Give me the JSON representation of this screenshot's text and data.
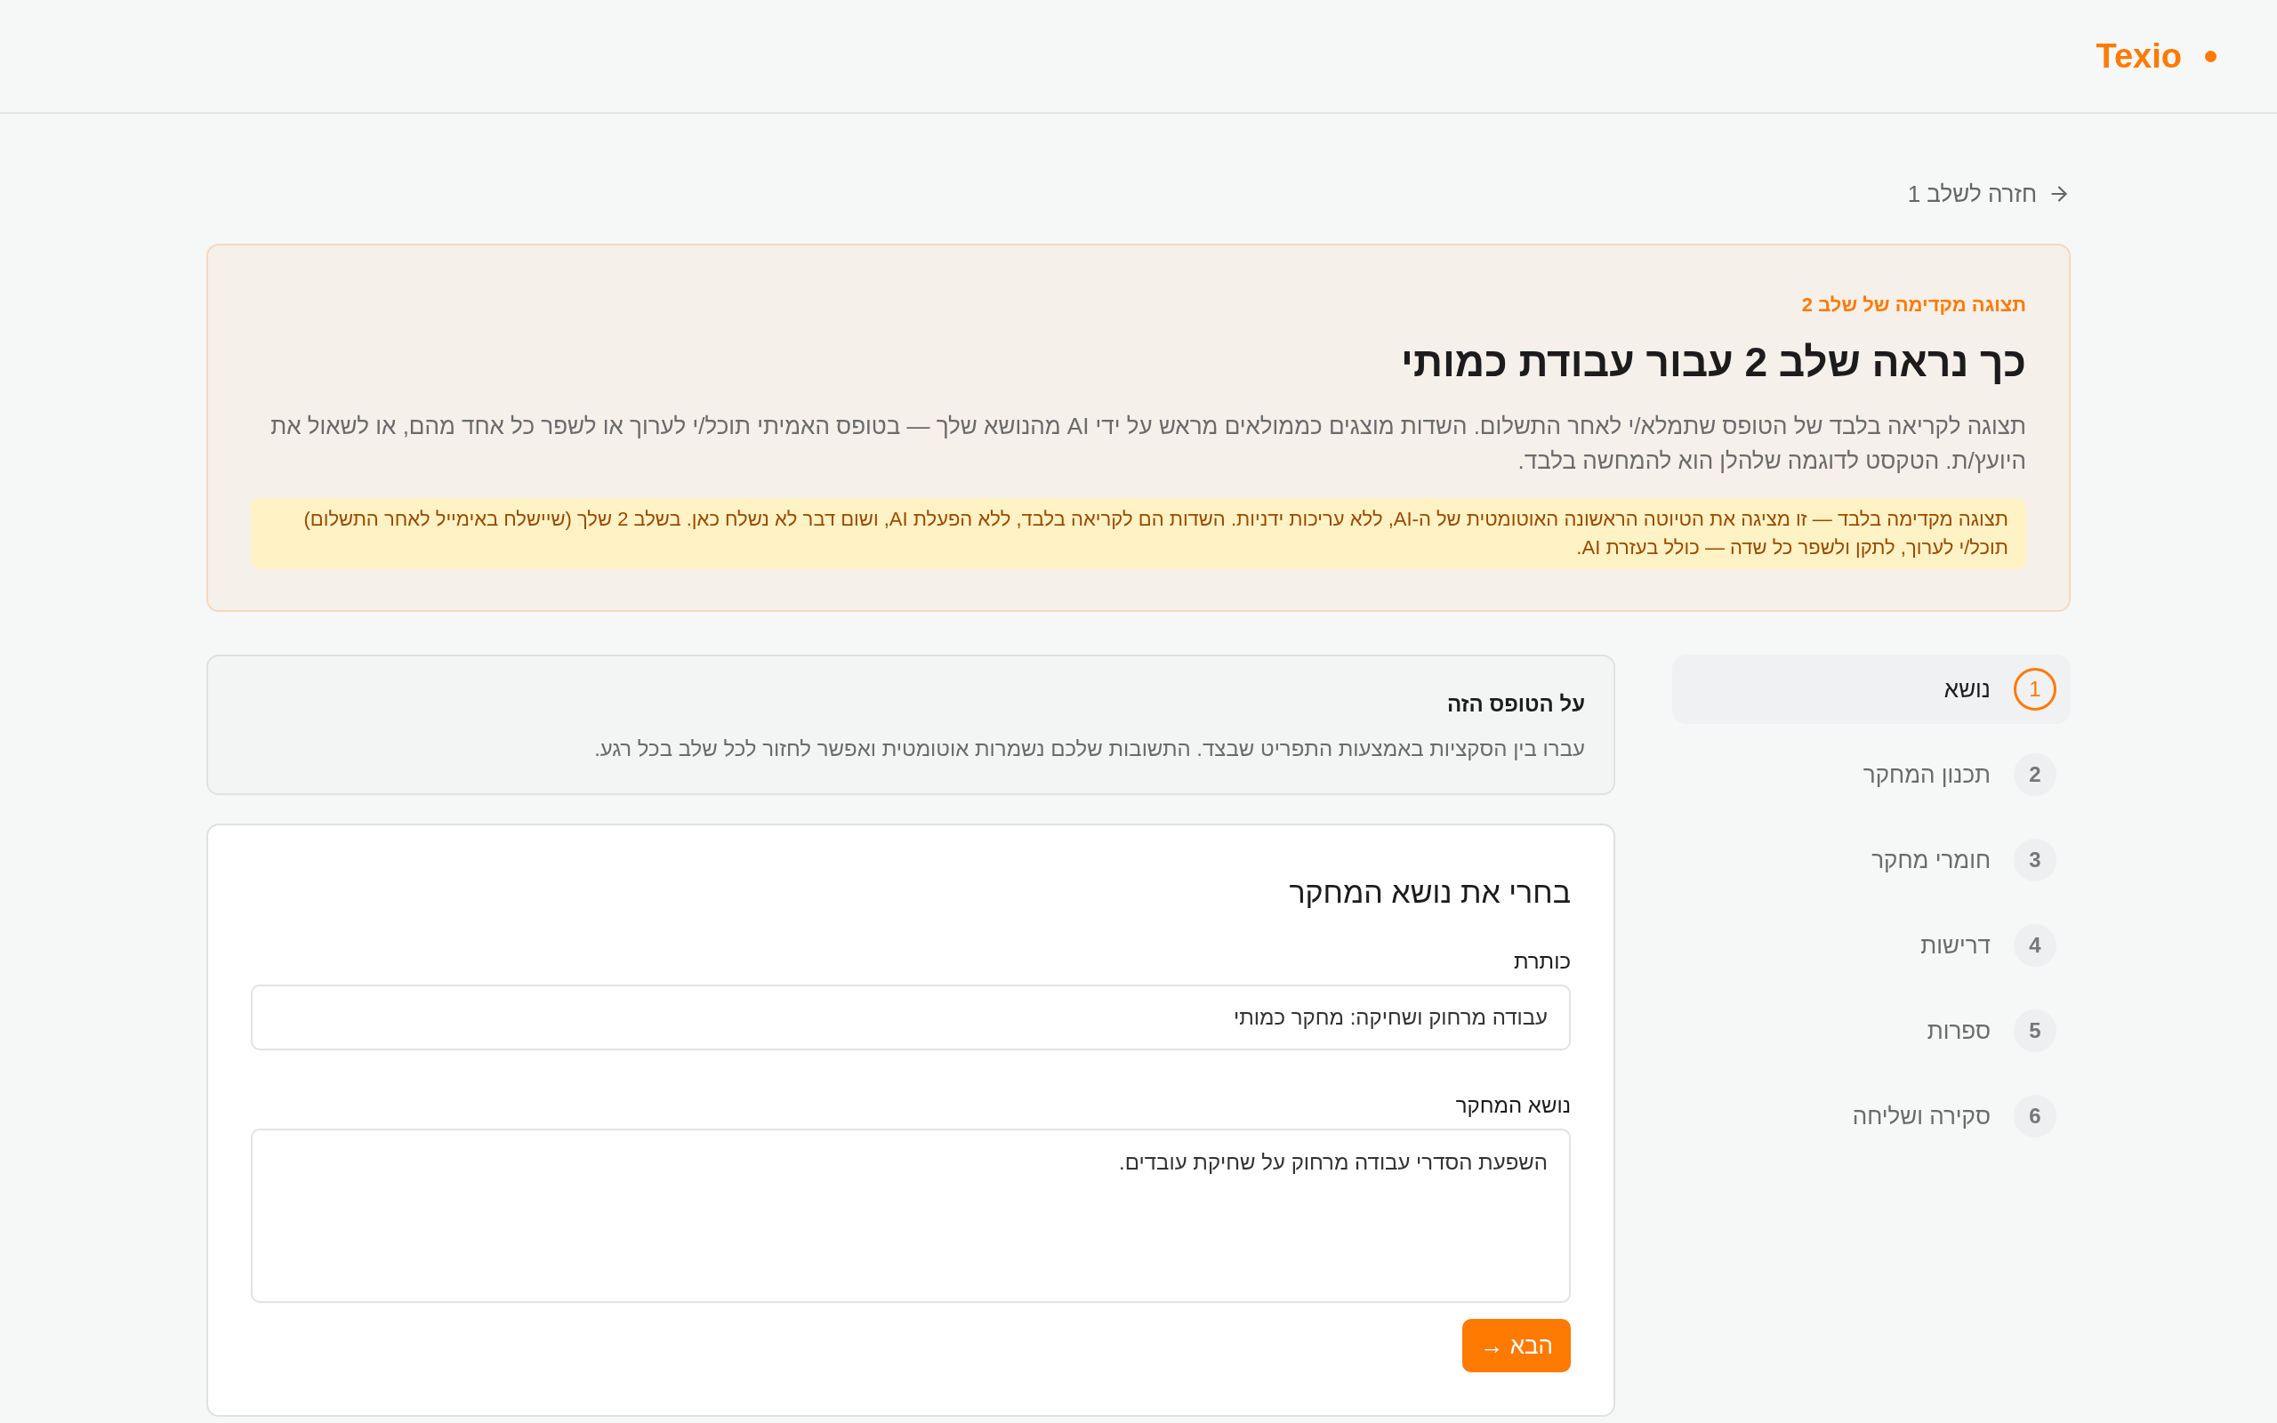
{
  "header": {
    "logo": "Texio"
  },
  "back_link": "חזרה לשלב 1",
  "preview_banner": {
    "eyebrow": "תצוגה מקדימה של שלב 2",
    "title": "כך נראה שלב 2 עבור עבודת כמותי",
    "description": "תצוגה לקריאה בלבד של הטופס שתמלא/י לאחר התשלום. השדות מוצגים כממולאים מראש על ידי AI מהנושא שלך — בטופס האמיתי תוכל/י לערוך או לשפר כל אחד מהם, או לשאול את היועץ/ת. הטקסט לדוגמה שלהלן הוא להמחשה בלבד.",
    "notice": "תצוגה מקדימה בלבד — זו מציגה את הטיוטה הראשונה האוטומטית של ה-AI, ללא עריכות ידניות. השדות הם לקריאה בלבד, ללא הפעלת AI, ושום דבר לא נשלח כאן. בשלב 2 שלך (שיישלח באימייל לאחר התשלום) תוכל/י לערוך, לתקן ולשפר כל שדה — כולל בעזרת AI."
  },
  "steps": [
    {
      "number": "1",
      "label": "נושא",
      "selected": true
    },
    {
      "number": "2",
      "label": "תכנון המחקר",
      "selected": false
    },
    {
      "number": "3",
      "label": "חומרי מחקר",
      "selected": false
    },
    {
      "number": "4",
      "label": "דרישות",
      "selected": false
    },
    {
      "number": "5",
      "label": "ספרות",
      "selected": false
    },
    {
      "number": "6",
      "label": "סקירה ושליחה",
      "selected": false
    }
  ],
  "info_card": {
    "title": "על הטופס הזה",
    "text": "עברו בין הסקציות באמצעות התפריט שבצד. התשובות שלכם נשמרות אוטומטית ואפשר לחזור לכל שלב בכל רגע."
  },
  "form": {
    "heading": "בחרי את נושא המחקר",
    "fields": [
      {
        "kind": "input",
        "label": "כותרת",
        "value": "עבודה מרחוק ושחיקה: מחקר כמותי"
      },
      {
        "kind": "textarea",
        "label": "נושא המחקר",
        "value": "השפעת הסדרי עבודה מרחוק על שחיקת עובדים."
      }
    ],
    "next_button": "הבא →"
  }
}
